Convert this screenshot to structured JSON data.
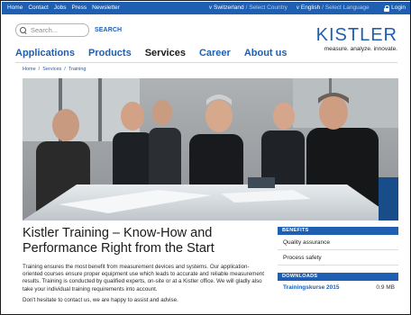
{
  "topbar": {
    "links": [
      "Home",
      "Contact",
      "Jobs",
      "Press",
      "Newsletter"
    ],
    "country": {
      "chevron": "v",
      "value": "Switzerland",
      "hint": "/ Select Country"
    },
    "language": {
      "chevron": "v",
      "value": "English",
      "hint": "/ Select Language"
    },
    "login_label": "Login"
  },
  "search": {
    "placeholder": "Search...",
    "button_label": "SEARCH"
  },
  "logo": {
    "wordmark": "KISTLER",
    "tagline": "measure. analyze. innovate."
  },
  "nav": {
    "items": [
      "Applications",
      "Products",
      "Services",
      "Career",
      "About us"
    ],
    "active": "Services"
  },
  "breadcrumb": {
    "items": [
      "Home",
      "Services",
      "Training"
    ],
    "separator": "/"
  },
  "hero": {
    "icon": "team-training-photo"
  },
  "main": {
    "title": "Kistler Training – Know-How and Performance Right from the Start",
    "paragraph1": "Training ensures the most benefit from measurement devices and systems. Our application-oriented courses ensure proper equipment use which leads to accurate and reliable measurement results. Training is conducted by qualified experts, on-site or at a Kistler office. We will gladly also take your individual training requirements into account.",
    "paragraph2": "Don't hesitate to contact us, we are happy to assist and advise."
  },
  "sidebar": {
    "benefits_heading": "BENEFITS",
    "benefits": [
      "Quality assurance",
      "Process safety"
    ],
    "downloads_heading": "DOWNLOADS",
    "downloads": [
      {
        "name": "Trainingskurse 2015",
        "size": "0.9 MB"
      }
    ]
  },
  "colors": {
    "brand_blue": "#1f5fb2",
    "text": "#1a1a1a"
  }
}
